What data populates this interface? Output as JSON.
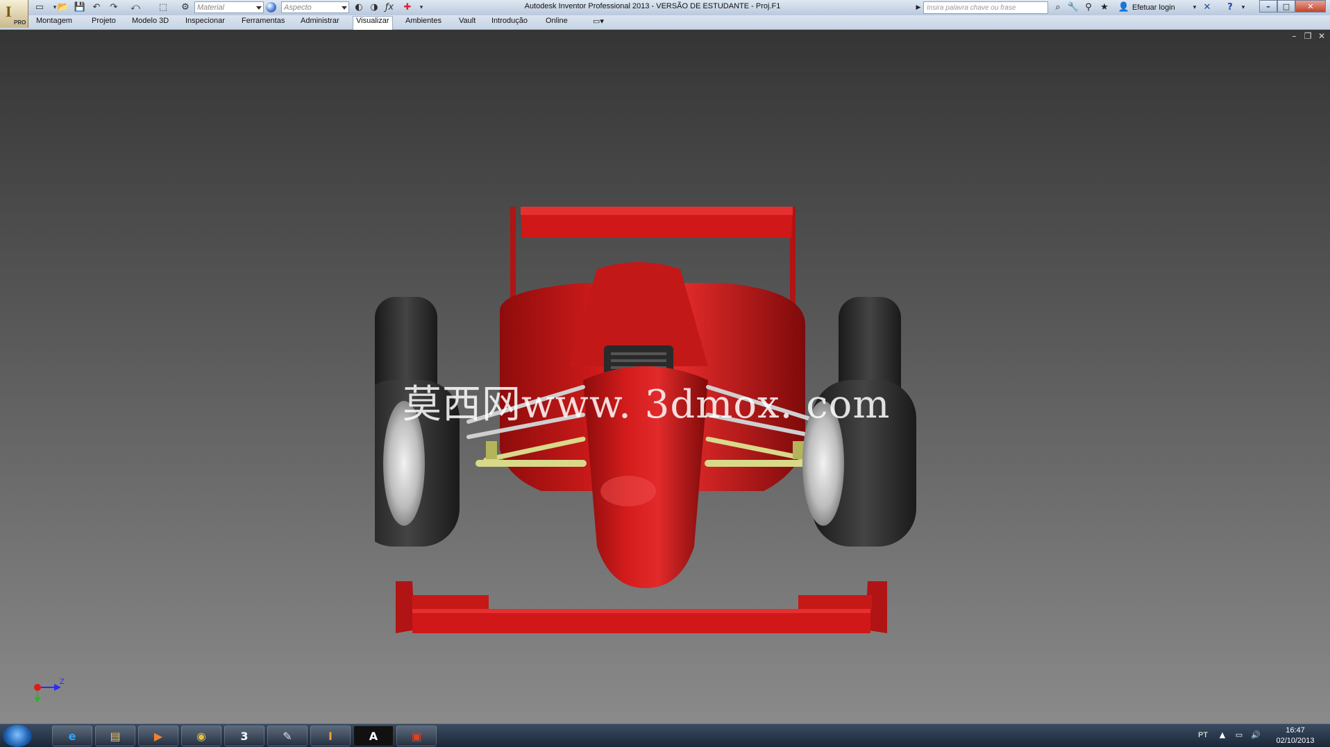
{
  "app": {
    "logo_letter": "I",
    "edition_badge": "PRO",
    "window_title": "Autodesk Inventor Professional 2013 - VERSÃO DE ESTUDANTE - Proj.F1"
  },
  "quick_access": {
    "material_placeholder": "Material",
    "appearance_placeholder": "Aspecto",
    "icons": [
      "new-icon",
      "open-icon",
      "save-icon",
      "undo-icon",
      "redo-icon",
      "return-icon",
      "select-icon",
      "update-icon",
      "material-combo",
      "appearance-combo",
      "measure-icon",
      "parameters-icon",
      "add-icon"
    ]
  },
  "help": {
    "search_placeholder": "Insira palavra chave ou frase",
    "login_label": "Efetuar login"
  },
  "menu_tabs": [
    {
      "label": "Montagem"
    },
    {
      "label": "Projeto"
    },
    {
      "label": "Modelo 3D"
    },
    {
      "label": "Inspecionar"
    },
    {
      "label": "Ferramentas"
    },
    {
      "label": "Administrar"
    },
    {
      "label": "Visualizar",
      "active": true
    },
    {
      "label": "Ambientes"
    },
    {
      "label": "Vault"
    },
    {
      "label": "Introdução"
    },
    {
      "label": "Online"
    }
  ],
  "viewport": {
    "watermark": "莫西网www. 3dmox. com",
    "axis_label": "Z",
    "model_color": "#d11818"
  },
  "taskbar": {
    "apps": [
      "internet-explorer",
      "file-explorer",
      "media-player",
      "chrome",
      "3ds-max",
      "paint",
      "inventor",
      "autocad",
      "presentation"
    ],
    "language": "PT",
    "time": "16:47",
    "date": "02/10/2013"
  },
  "colors": {
    "titlebar": "#c7d4e5",
    "car_red": "#d11818",
    "tire": "#2a2a2a",
    "suspension_yellow": "#d9d98a"
  }
}
